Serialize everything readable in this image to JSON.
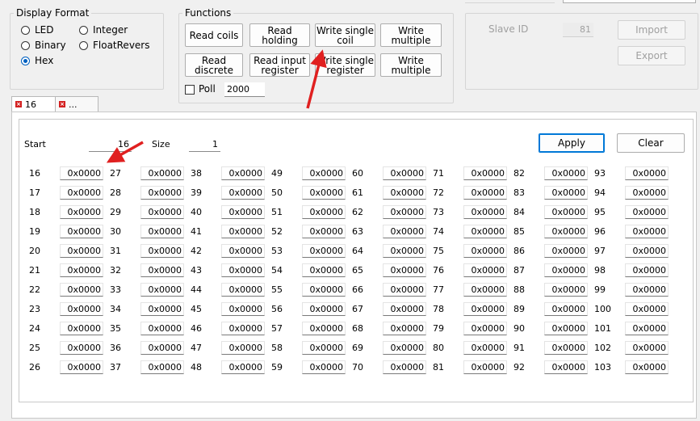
{
  "display_format": {
    "title": "Display Format",
    "options": [
      {
        "label": "LED",
        "selected": false
      },
      {
        "label": "Integer",
        "selected": false
      },
      {
        "label": "Binary",
        "selected": false
      },
      {
        "label": "FloatRevers",
        "selected": false
      },
      {
        "label": "Hex",
        "selected": true
      }
    ]
  },
  "functions": {
    "title": "Functions",
    "buttons": {
      "read_coils": "Read coils",
      "read_holding": "Read\nholding",
      "write_single_coil": "Write single\ncoil",
      "write_multiple_1": "Write\nmultiple",
      "read_discrete": "Read\ndiscrete",
      "read_input_register": "Read input\nregister",
      "write_single_register": "Write single\nregister",
      "write_multiple_2": "Write\nmultiple"
    },
    "poll_label": "Poll",
    "poll_value": "2000",
    "poll_checked": false
  },
  "slave": {
    "slave_id_label": "Slave ID",
    "slave_id_value": "81",
    "import_label": "Import",
    "export_label": "Export"
  },
  "tabs": [
    {
      "label": "16",
      "active": true
    },
    {
      "label": "...",
      "active": false
    }
  ],
  "controls": {
    "start_label": "Start",
    "start_value": "16",
    "size_label": "Size",
    "size_value": "1",
    "apply_label": "Apply",
    "clear_label": "Clear"
  },
  "registers": {
    "columns": [
      [
        "16",
        "17",
        "18",
        "19",
        "20",
        "21",
        "22",
        "23",
        "24",
        "25",
        "26"
      ],
      [
        "27",
        "28",
        "29",
        "30",
        "31",
        "32",
        "33",
        "34",
        "35",
        "36",
        "37"
      ],
      [
        "38",
        "39",
        "40",
        "41",
        "42",
        "43",
        "44",
        "45",
        "46",
        "47",
        "48"
      ],
      [
        "49",
        "50",
        "51",
        "52",
        "53",
        "54",
        "55",
        "56",
        "57",
        "58",
        "59"
      ],
      [
        "60",
        "61",
        "62",
        "63",
        "64",
        "65",
        "66",
        "67",
        "68",
        "69",
        "70"
      ],
      [
        "71",
        "72",
        "73",
        "74",
        "75",
        "76",
        "77",
        "78",
        "79",
        "80",
        "81"
      ],
      [
        "82",
        "83",
        "84",
        "85",
        "86",
        "87",
        "88",
        "89",
        "90",
        "91",
        "92"
      ],
      [
        "93",
        "94",
        "95",
        "96",
        "97",
        "98",
        "99",
        "100",
        "101",
        "102",
        "103"
      ]
    ],
    "value": "0x0000"
  },
  "colors": {
    "annotation_arrow": "#e02020",
    "accent": "#0078d7"
  }
}
